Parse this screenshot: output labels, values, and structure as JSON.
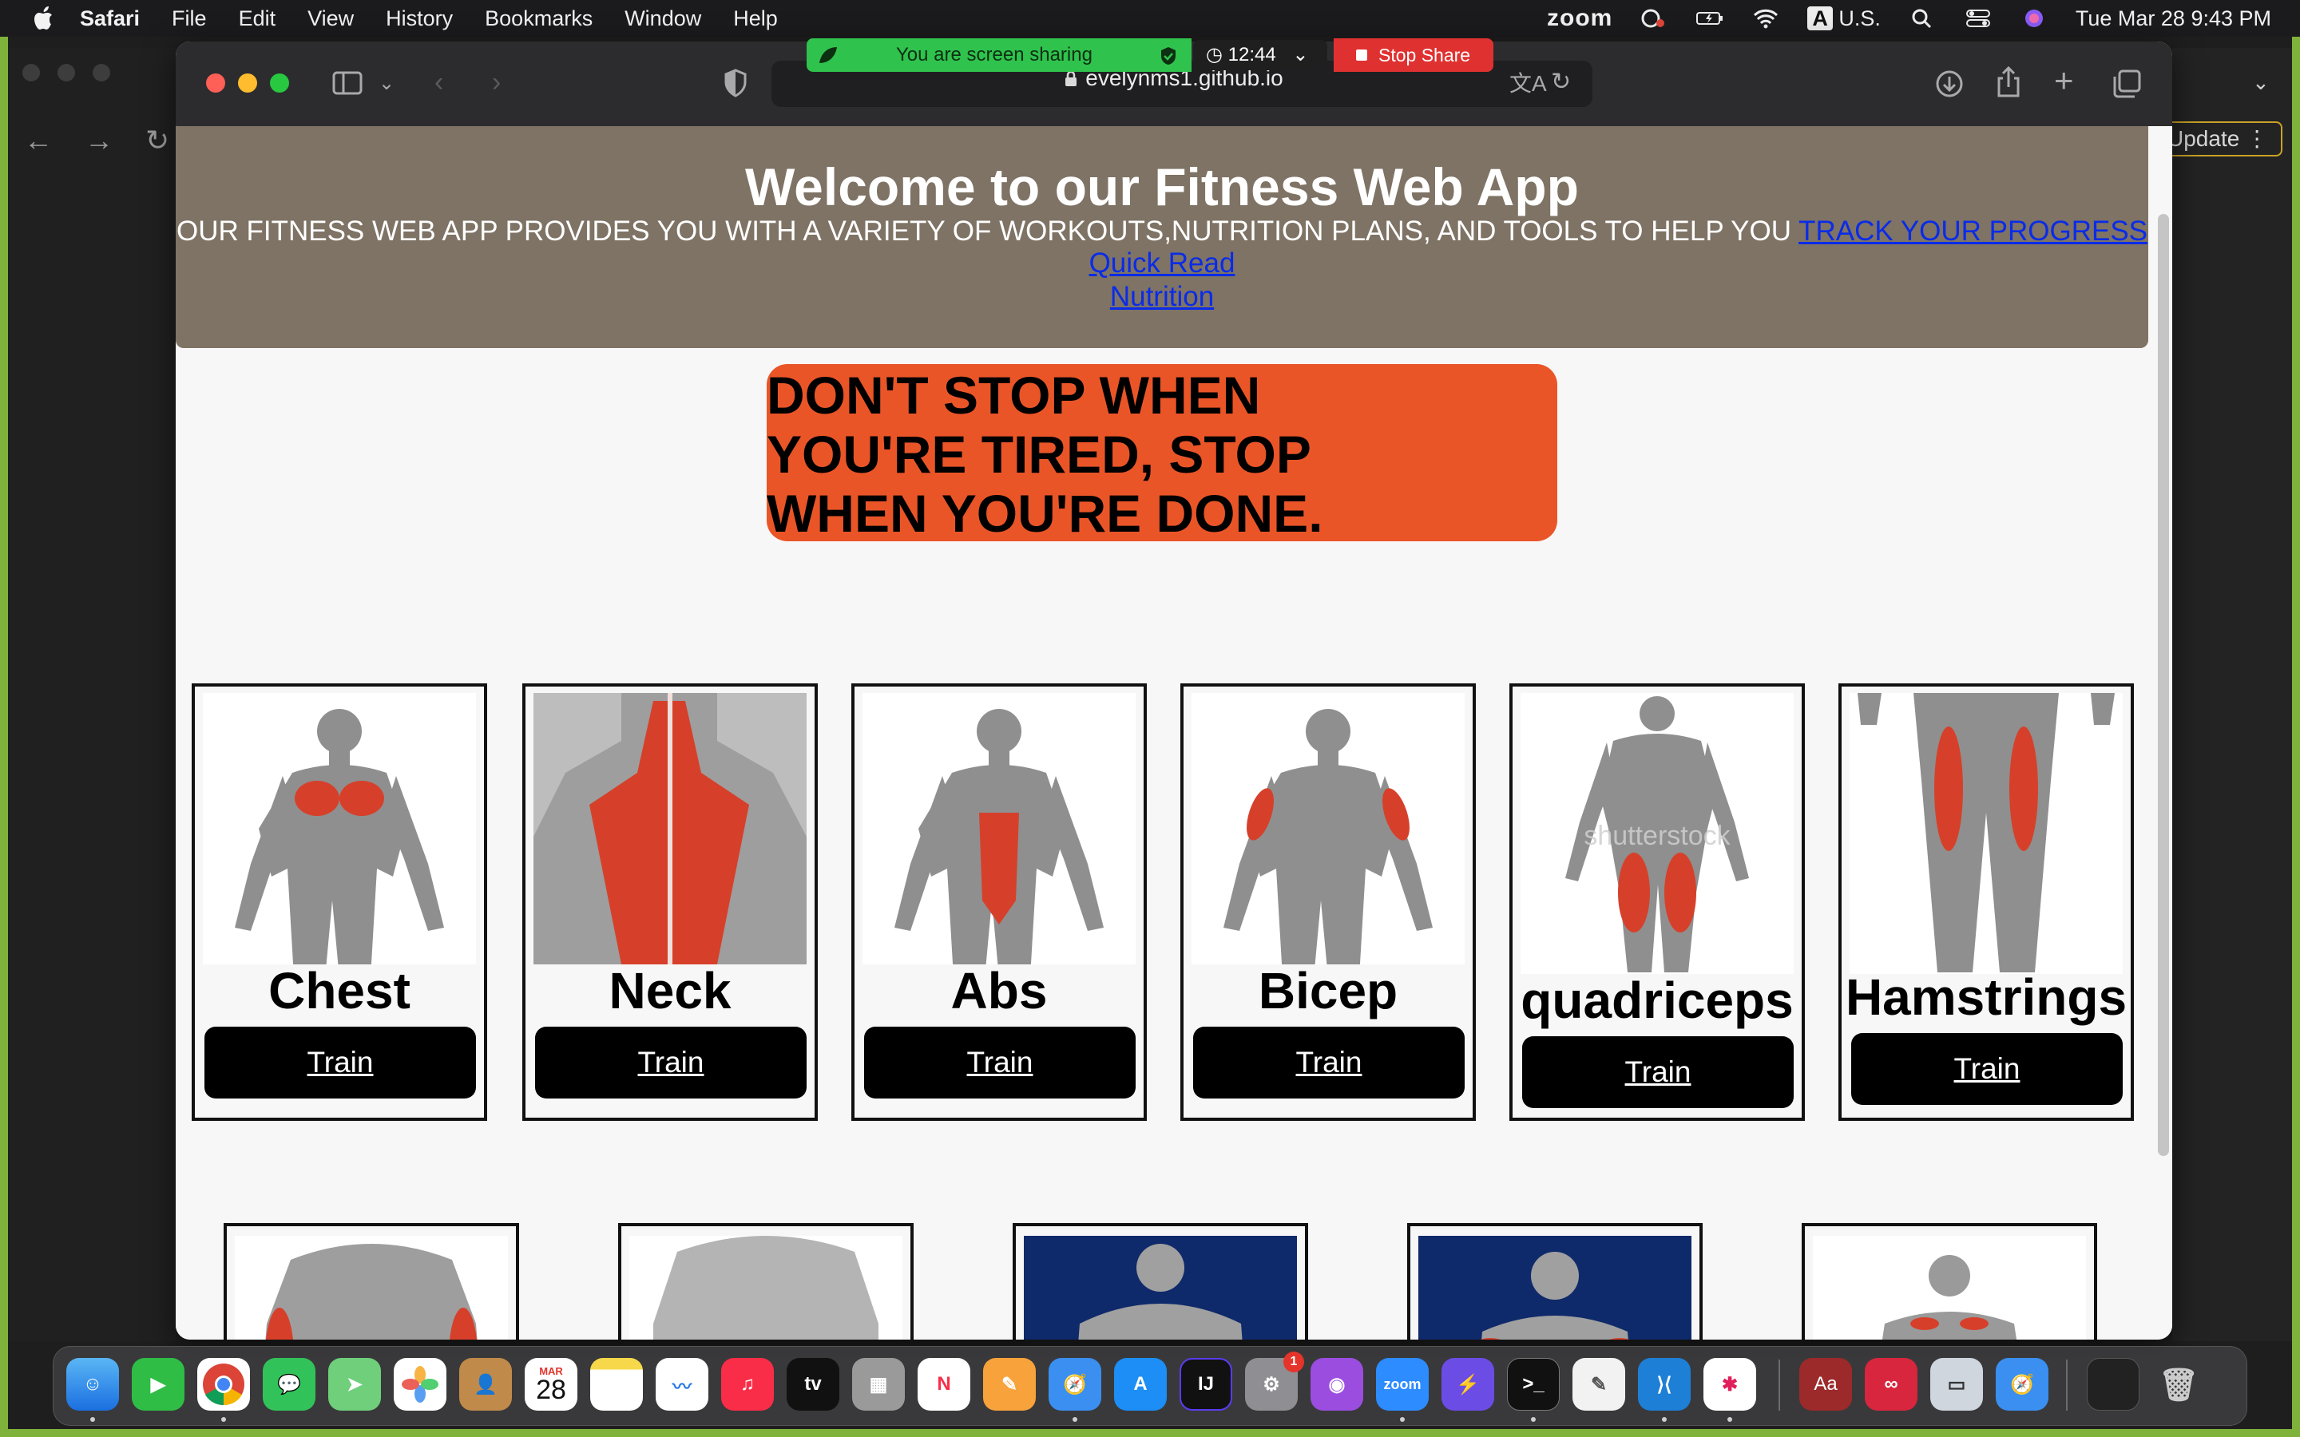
{
  "menubar": {
    "app_name": "Safari",
    "menus": [
      "File",
      "Edit",
      "View",
      "History",
      "Bookmarks",
      "Window",
      "Help"
    ],
    "zoom_label": "zoom",
    "input_source": "A",
    "input_locale": "U.S.",
    "datetime": "Tue Mar 28  9:43 PM"
  },
  "screen_share": {
    "status": "You are screen sharing",
    "timer": "12:44",
    "stop_label": "Stop Share"
  },
  "browser": {
    "url": "evelynms1.github.io"
  },
  "background_app": {
    "update_label": "Update"
  },
  "site": {
    "title": "Welcome to our Fitness Web App",
    "subtitle": "OUR FITNESS WEB APP PROVIDES YOU WITH A VARIETY OF WORKOUTS,NUTRITION PLANS, AND TOOLS TO HELP YOU ",
    "subtitle_link": "TRACK YOUR PROGRESS",
    "nav": [
      "Quick Read",
      "Nutrition"
    ],
    "quote": "DON'T STOP WHEN YOU'RE TIRED, STOP WHEN YOU'RE DONE.",
    "train_label": "Train",
    "cards": [
      {
        "title": "Chest",
        "highlight": "chest"
      },
      {
        "title": "Neck",
        "highlight": "upper-back"
      },
      {
        "title": "Abs",
        "highlight": "abs"
      },
      {
        "title": "Bicep",
        "highlight": "biceps"
      },
      {
        "title": "quadriceps",
        "highlight": "quads"
      },
      {
        "title": "Hamstrings",
        "highlight": "hamstrings"
      }
    ],
    "watermark": "shutterstock"
  },
  "dock": {
    "calendar_month": "MAR",
    "calendar_day": "28",
    "settings_badge": "1",
    "zoom_label": "zoom",
    "dictionary_label": "Aa",
    "intellij_label": "IJ"
  },
  "colors": {
    "header_bg": "#7e7365",
    "quote_bg": "#ea5528",
    "link": "#0a2be8",
    "muscle": "#d6402a",
    "share_green": "#2fc24d",
    "share_red": "#e03131"
  }
}
